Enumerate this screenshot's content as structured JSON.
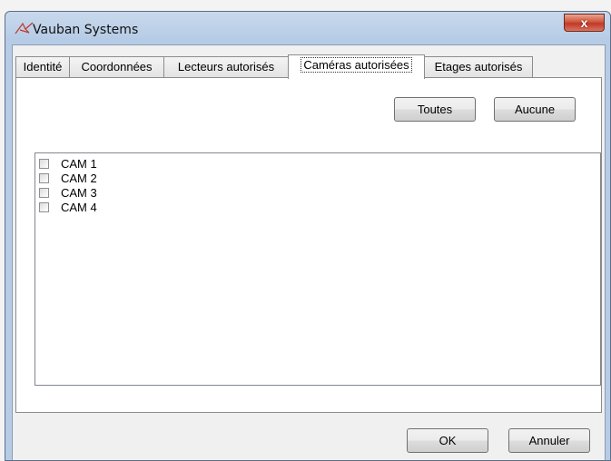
{
  "window": {
    "title": "Vauban Systems",
    "close_label": "x"
  },
  "tabs": [
    {
      "label": "Identité"
    },
    {
      "label": "Coordonnées"
    },
    {
      "label": "Lecteurs autorisés"
    },
    {
      "label": "Caméras autorisées",
      "active": true
    },
    {
      "label": "Etages autorisés"
    }
  ],
  "panel": {
    "select_all_label": "Toutes",
    "select_none_label": "Aucune",
    "cameras": [
      {
        "label": "CAM 1",
        "checked": false
      },
      {
        "label": "CAM 2",
        "checked": false
      },
      {
        "label": "CAM 3",
        "checked": false
      },
      {
        "label": "CAM 4",
        "checked": false
      }
    ]
  },
  "footer": {
    "ok_label": "OK",
    "cancel_label": "Annuler"
  }
}
